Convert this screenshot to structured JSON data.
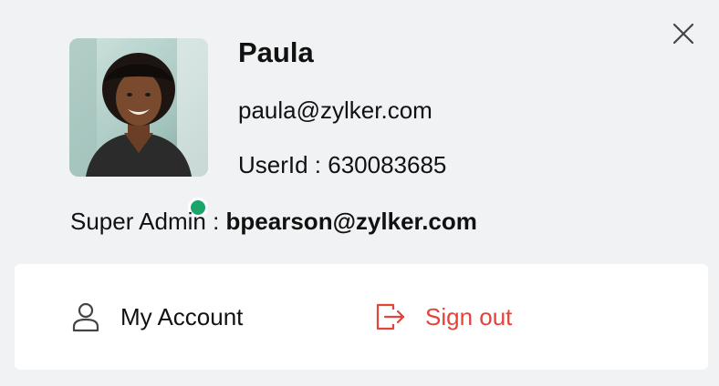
{
  "profile": {
    "name": "Paula",
    "email": "paula@zylker.com",
    "user_id_label": "UserId : 630083685",
    "status": "online",
    "super_admin_label": "Super Admin : ",
    "super_admin_email": "bpearson@zylker.com"
  },
  "actions": {
    "my_account_label": "My Account",
    "sign_out_label": "Sign out"
  },
  "icons": {
    "close": "close-icon",
    "account": "user-icon",
    "sign_out": "sign-out-icon"
  },
  "colors": {
    "background": "#f1f2f4",
    "card": "#ffffff",
    "status_online": "#1aa66a",
    "sign_out": "#e2443a",
    "text": "#111111"
  }
}
